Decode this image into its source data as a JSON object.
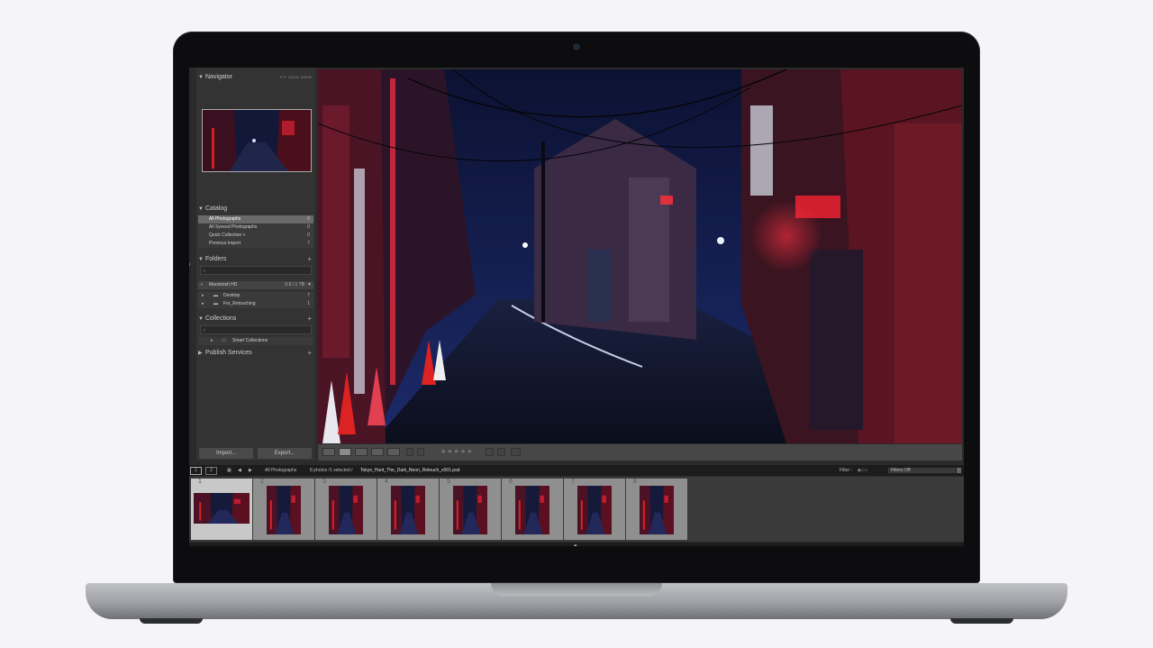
{
  "navigator": {
    "title": "Navigator",
    "zoom_options": "FIT  100%  300%"
  },
  "catalog": {
    "title": "Catalog",
    "items": [
      {
        "label": "All Photographs",
        "count": "8"
      },
      {
        "label": "All Synced Photographs",
        "count": "0"
      },
      {
        "label": "Quick Collection +",
        "count": "0"
      },
      {
        "label": "Previous Import",
        "count": "7"
      }
    ]
  },
  "folders": {
    "title": "Folders",
    "volume": {
      "label": "Macintosh HD",
      "info": "0.6 / 1 TB"
    },
    "items": [
      {
        "label": "Desktop",
        "count": "7"
      },
      {
        "label": "For_Retouching",
        "count": "1"
      }
    ]
  },
  "collections": {
    "title": "Collections",
    "items": [
      {
        "label": "Smart Collections"
      }
    ]
  },
  "publish": {
    "title": "Publish Services"
  },
  "buttons": {
    "import": "Import...",
    "export": "Export..."
  },
  "filmstrip": {
    "source": "All Photographs",
    "status": "8 photos /1 selected /",
    "filename": "Tokyo_Hunt_The_Dark_Neon_Retouch_v001.psd",
    "filter_label": "Filter :",
    "filter_value": "Filters Off",
    "view1": "1",
    "view2": "2",
    "numbers": [
      "1",
      "2",
      "3",
      "4",
      "5",
      "6",
      "7",
      "8"
    ]
  },
  "colors": {
    "accent_red": "#c8283a",
    "accent_blue": "#1a2a66",
    "panel": "#333333"
  }
}
